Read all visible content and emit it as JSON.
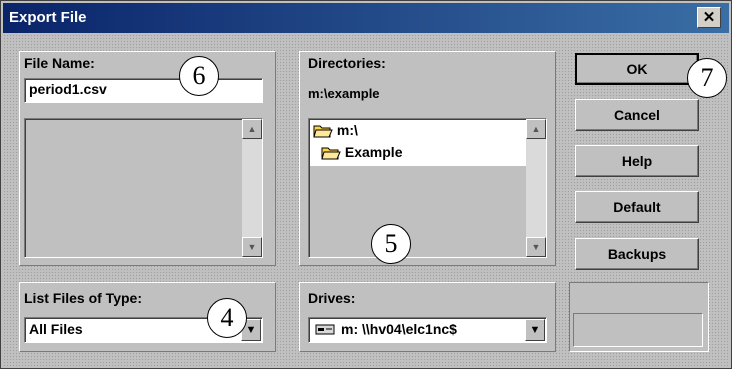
{
  "window": {
    "title": "Export File",
    "close_glyph": "✕"
  },
  "file_name": {
    "label": "File Name:",
    "value": "period1.csv"
  },
  "directories": {
    "label": "Directories:",
    "current_path": "m:\\example",
    "tree": [
      {
        "label": "m:\\",
        "icon": "open-folder-icon"
      },
      {
        "label": "Example",
        "icon": "open-folder-icon"
      }
    ]
  },
  "file_type": {
    "label": "List Files of Type:",
    "value": "All Files"
  },
  "drives": {
    "label": "Drives:",
    "value": "m: \\\\hv04\\elc1nc$",
    "icon": "network-drive-icon"
  },
  "buttons": {
    "ok": "OK",
    "cancel": "Cancel",
    "help": "Help",
    "default": "Default",
    "backups": "Backups"
  },
  "callouts": {
    "four": "4",
    "five": "5",
    "six": "6",
    "seven": "7"
  },
  "glyphs": {
    "up": "▲",
    "down": "▼"
  },
  "colors": {
    "titlebar_start": "#0a246a",
    "titlebar_end": "#3a6ea5",
    "face": "#c0c0c0",
    "folder": "#ffd24a"
  }
}
